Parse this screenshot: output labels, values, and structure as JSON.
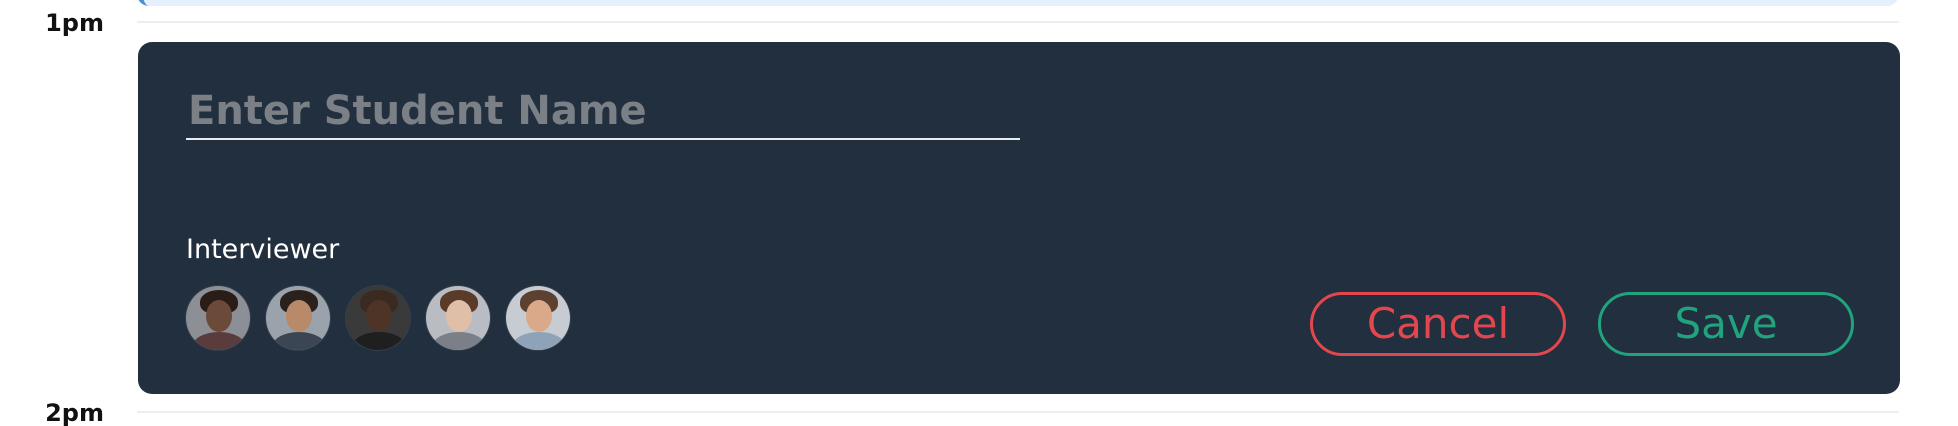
{
  "time_labels": {
    "first": "1pm",
    "second": "2pm"
  },
  "event_form": {
    "name_placeholder": "Enter Student Name",
    "name_value": "",
    "interviewer_label": "Interviewer",
    "interviewers": [
      {
        "name": "interviewer-1",
        "skin": "#6b4a3a",
        "hair": "#2a1d18",
        "bg": "#8c8f96",
        "shirt": "#5a3c3c"
      },
      {
        "name": "interviewer-2",
        "skin": "#b98a6a",
        "hair": "#2b211c",
        "bg": "#9aa2ab",
        "shirt": "#3c4554"
      },
      {
        "name": "interviewer-3",
        "skin": "#4d3426",
        "hair": "#3a2a22",
        "bg": "#3a3a3a",
        "shirt": "#1f1f1f"
      },
      {
        "name": "interviewer-4",
        "skin": "#e0bfa8",
        "hair": "#5a3a28",
        "bg": "#b9bcc2",
        "shirt": "#7a7f88"
      },
      {
        "name": "interviewer-5",
        "skin": "#d9a98a",
        "hair": "#5c4030",
        "bg": "#c7ccd2",
        "shirt": "#8fa3b8"
      }
    ],
    "cancel_label": "Cancel",
    "save_label": "Save"
  },
  "colors": {
    "card_bg": "#222f3e",
    "cancel": "#e3474d",
    "save": "#1fa47e",
    "prev_event_bg": "#e4f0fd",
    "prev_event_accent": "#4a90d9"
  }
}
